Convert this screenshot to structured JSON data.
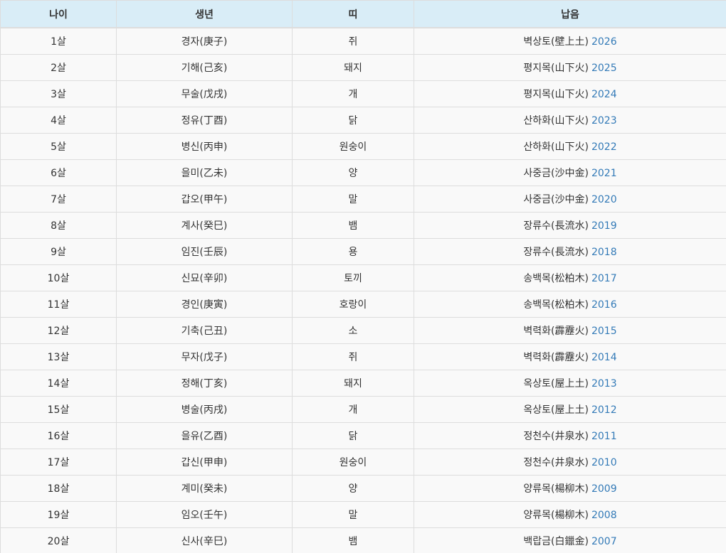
{
  "header": {
    "age": "나이",
    "birth_year": "생년",
    "zodiac": "띠",
    "napeum": "납음"
  },
  "rows": [
    {
      "age": "1살",
      "ganji": "경자(庚子)",
      "zodiac": "쥐",
      "napeum": "벽상토(壁上土)",
      "year": "2026"
    },
    {
      "age": "2살",
      "ganji": "기해(己亥)",
      "zodiac": "돼지",
      "napeum": "평지목(山下火)",
      "year": "2025"
    },
    {
      "age": "3살",
      "ganji": "무술(戊戌)",
      "zodiac": "개",
      "napeum": "평지목(山下火)",
      "year": "2024"
    },
    {
      "age": "4살",
      "ganji": "정유(丁酉)",
      "zodiac": "닭",
      "napeum": "산하화(山下火)",
      "year": "2023"
    },
    {
      "age": "5살",
      "ganji": "병신(丙申)",
      "zodiac": "원숭이",
      "napeum": "산하화(山下火)",
      "year": "2022"
    },
    {
      "age": "6살",
      "ganji": "을미(乙未)",
      "zodiac": "양",
      "napeum": "사중금(沙中金)",
      "year": "2021"
    },
    {
      "age": "7살",
      "ganji": "갑오(甲午)",
      "zodiac": "말",
      "napeum": "사중금(沙中金)",
      "year": "2020"
    },
    {
      "age": "8살",
      "ganji": "계사(癸巳)",
      "zodiac": "뱀",
      "napeum": "장류수(長流水)",
      "year": "2019"
    },
    {
      "age": "9살",
      "ganji": "임진(壬辰)",
      "zodiac": "용",
      "napeum": "장류수(長流水)",
      "year": "2018"
    },
    {
      "age": "10살",
      "ganji": "신묘(辛卯)",
      "zodiac": "토끼",
      "napeum": "송백목(松柏木)",
      "year": "2017"
    },
    {
      "age": "11살",
      "ganji": "경인(庚寅)",
      "zodiac": "호랑이",
      "napeum": "송백목(松柏木)",
      "year": "2016"
    },
    {
      "age": "12살",
      "ganji": "기축(己丑)",
      "zodiac": "소",
      "napeum": "벽력화(霹靂火)",
      "year": "2015"
    },
    {
      "age": "13살",
      "ganji": "무자(戊子)",
      "zodiac": "쥐",
      "napeum": "벽력화(霹靂火)",
      "year": "2014"
    },
    {
      "age": "14살",
      "ganji": "정해(丁亥)",
      "zodiac": "돼지",
      "napeum": "옥상토(屋上土)",
      "year": "2013"
    },
    {
      "age": "15살",
      "ganji": "병술(丙戌)",
      "zodiac": "개",
      "napeum": "옥상토(屋上土)",
      "year": "2012"
    },
    {
      "age": "16살",
      "ganji": "을유(乙酉)",
      "zodiac": "닭",
      "napeum": "정천수(井泉水)",
      "year": "2011"
    },
    {
      "age": "17살",
      "ganji": "갑신(甲申)",
      "zodiac": "원숭이",
      "napeum": "정천수(井泉水)",
      "year": "2010"
    },
    {
      "age": "18살",
      "ganji": "계미(癸未)",
      "zodiac": "양",
      "napeum": "양류목(楊柳木)",
      "year": "2009"
    },
    {
      "age": "19살",
      "ganji": "임오(壬午)",
      "zodiac": "말",
      "napeum": "양류목(楊柳木)",
      "year": "2008"
    },
    {
      "age": "20살",
      "ganji": "신사(辛巳)",
      "zodiac": "뱀",
      "napeum": "백랍금(白鑞金)",
      "year": "2007"
    }
  ],
  "colors": {
    "header_bg": "#d9edf7",
    "row_bg": "#f9f9f9",
    "year_link": "#337ab7",
    "border": "#dddddd"
  }
}
